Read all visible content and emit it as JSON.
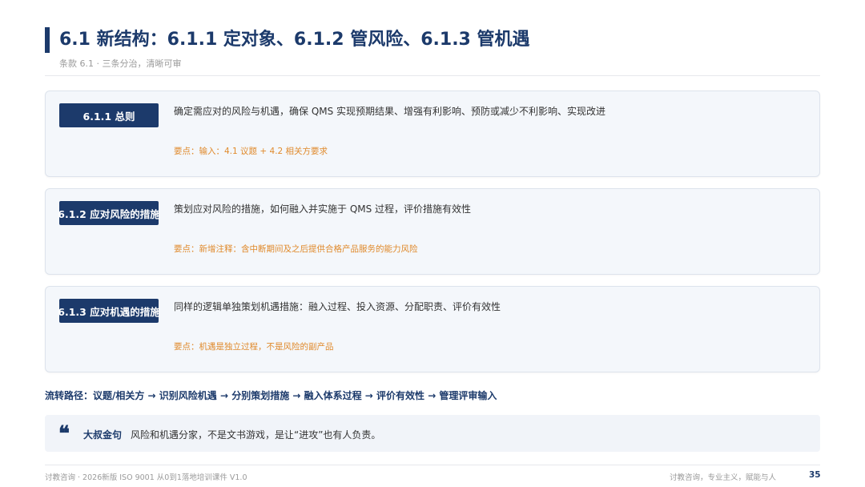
{
  "header": {
    "title": "6.1 新结构：6.1.1 定对象、6.1.2 管风险、6.1.3 管机遇",
    "subtitle": "条款 6.1 · 三条分治，清晰可审"
  },
  "cards": [
    {
      "badge": "6.1.1 总则",
      "text": "确定需应对的风险与机遇，确保 QMS 实现预期结果、增强有利影响、预防或减少不利影响、实现改进",
      "point": "要点：输入：4.1 议题 + 4.2 相关方要求"
    },
    {
      "badge": "6.1.2 应对风险的措施",
      "text": "策划应对风险的措施，如何融入并实施于 QMS 过程，评价措施有效性",
      "point": "要点：新增注释：含中断期间及之后提供合格产品服务的能力风险"
    },
    {
      "badge": "6.1.3 应对机遇的措施",
      "text": "同样的逻辑单独策划机遇措施：融入过程、投入资源、分配职责、评价有效性",
      "point": "要点：机遇是独立过程，不是风险的副产品"
    }
  ],
  "flow": "流转路径：议题/相关方 → 识别风险机遇 → 分别策划措施 → 融入体系过程 → 评价有效性 → 管理评审输入",
  "quote": {
    "mark": "❝",
    "label": "大叔金句",
    "text": "风险和机遇分家，不是文书游戏，是让“进攻”也有人负责。"
  },
  "footer": {
    "left": "讨教咨询 · 2026新版 ISO 9001 从0到1落地培训课件 V1.0",
    "right": "讨教咨询，专业主义，赋能与人",
    "page": "35"
  },
  "colors": {
    "primary": "#1c3a6b",
    "accent": "#e08a2c",
    "card_bg": "#f4f7fb"
  }
}
